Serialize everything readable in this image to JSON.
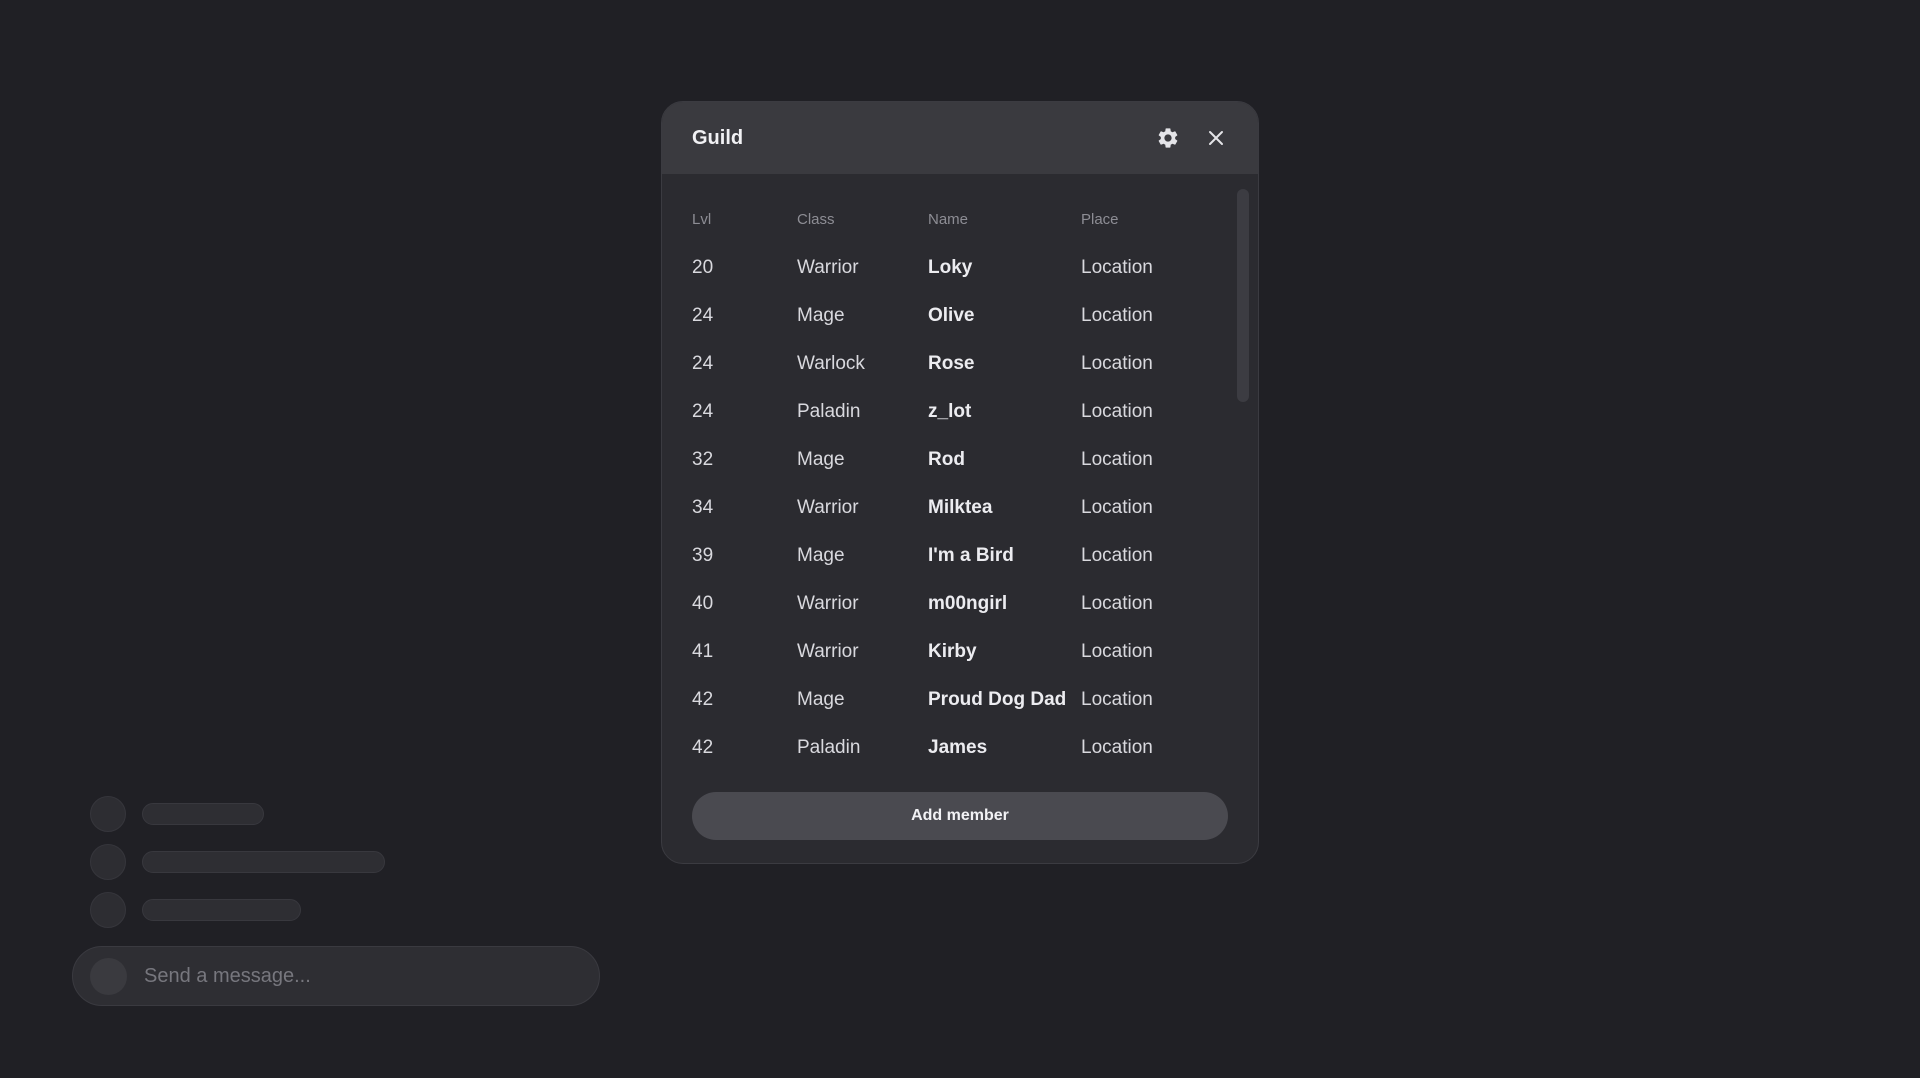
{
  "modal": {
    "title": "Guild",
    "settings_icon": "gear-icon",
    "close_icon": "close-icon",
    "columns": [
      "Lvl",
      "Class",
      "Name",
      "Place"
    ],
    "rows": [
      {
        "lvl": "20",
        "class": "Warrior",
        "name": "Loky",
        "place": "Location"
      },
      {
        "lvl": "24",
        "class": "Mage",
        "name": "Olive",
        "place": "Location"
      },
      {
        "lvl": "24",
        "class": "Warlock",
        "name": "Rose",
        "place": "Location"
      },
      {
        "lvl": "24",
        "class": "Paladin",
        "name": "z_lot",
        "place": "Location"
      },
      {
        "lvl": "32",
        "class": "Mage",
        "name": "Rod",
        "place": "Location"
      },
      {
        "lvl": "34",
        "class": "Warrior",
        "name": "Milktea",
        "place": "Location"
      },
      {
        "lvl": "39",
        "class": "Mage",
        "name": "I'm a Bird",
        "place": "Location"
      },
      {
        "lvl": "40",
        "class": "Warrior",
        "name": "m00ngirl",
        "place": "Location"
      },
      {
        "lvl": "41",
        "class": "Warrior",
        "name": "Kirby",
        "place": "Location"
      },
      {
        "lvl": "42",
        "class": "Mage",
        "name": "Proud Dog Dad",
        "place": "Location"
      },
      {
        "lvl": "42",
        "class": "Paladin",
        "name": "James",
        "place": "Location"
      }
    ],
    "add_button_label": "Add member"
  },
  "chat": {
    "message_placeholder": "Send a message..."
  },
  "colors": {
    "background": "#202025",
    "modal_background": "#2b2b30",
    "modal_header": "#3a3a3f",
    "button": "#4a4a50"
  }
}
